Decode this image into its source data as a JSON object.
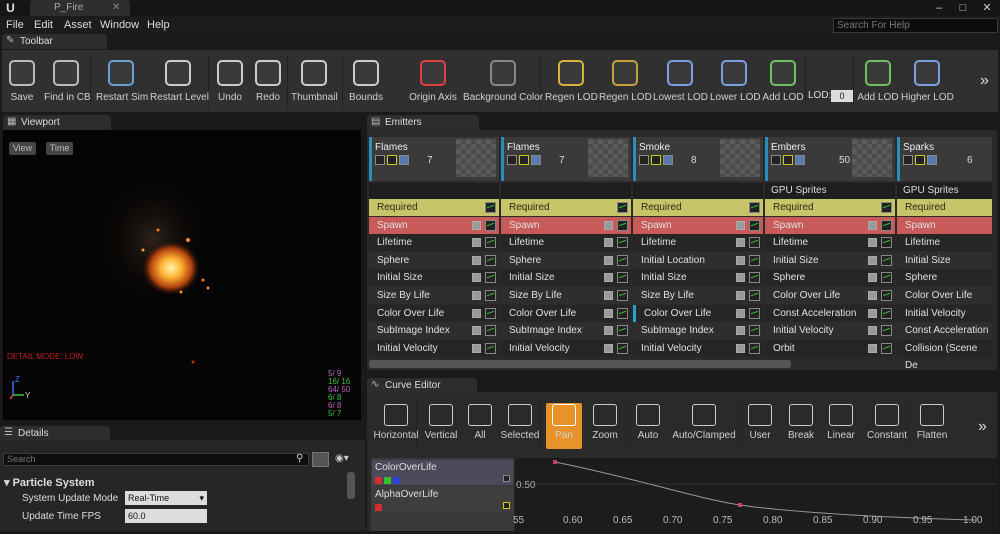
{
  "window": {
    "tab_title": "P_Fire",
    "logo": "U"
  },
  "menu": [
    "File",
    "Edit",
    "Asset",
    "Window",
    "Help"
  ],
  "help_search_placeholder": "Search For Help",
  "toolbar": {
    "tab": "Toolbar",
    "buttons": [
      {
        "label": "Save",
        "icon": "save-icon"
      },
      {
        "label": "Find in CB",
        "icon": "magnifier-icon"
      },
      {
        "label": "Restart Sim",
        "icon": "gear-icon"
      },
      {
        "label": "Restart Level",
        "icon": "refresh-icon"
      },
      {
        "label": "Undo",
        "icon": "undo-icon"
      },
      {
        "label": "Redo",
        "icon": "redo-icon"
      },
      {
        "label": "Thumbnail",
        "icon": "thumbnail-icon"
      },
      {
        "label": "Bounds",
        "icon": "bounds-icon"
      },
      {
        "label": "Origin Axis",
        "icon": "axis-icon"
      },
      {
        "label": "Background Color",
        "icon": "brush-icon"
      },
      {
        "label": "Regen LOD",
        "icon": "regen-lod-icon"
      },
      {
        "label": "Regen LOD",
        "icon": "regen-lod-alt-icon"
      },
      {
        "label": "Lowest LOD",
        "icon": "lowest-lod-icon"
      },
      {
        "label": "Lower LOD",
        "icon": "lower-lod-icon"
      },
      {
        "label": "Add LOD",
        "icon": "add-lod-icon"
      },
      {
        "label": "Add LOD",
        "icon": "add-lod-up-icon"
      },
      {
        "label": "Higher LOD",
        "icon": "higher-lod-icon"
      }
    ],
    "lod_label": "LOD:",
    "lod_value": "0"
  },
  "viewport": {
    "tab": "Viewport",
    "view_button": "View",
    "time_button": "Time",
    "detail_mode": "DETAIL MODE: LOW",
    "stats": [
      "5/ 9",
      "16/ 16",
      "64/ 50",
      "6/ 8",
      "6/ 8",
      "5/ 7"
    ]
  },
  "emitters": {
    "tab": "Emitters",
    "columns": [
      {
        "name": "Flames",
        "count": "7",
        "type": "",
        "color": "#2a8fbf",
        "modules": [
          "Required",
          "Spawn",
          "Lifetime",
          "Sphere",
          "Initial Size",
          "Size By Life",
          "Color Over Life",
          "SubImage Index",
          "Initial Velocity"
        ]
      },
      {
        "name": "Flames",
        "count": "7",
        "type": "",
        "color": "#2a8fbf",
        "modules": [
          "Required",
          "Spawn",
          "Lifetime",
          "Sphere",
          "Initial Size",
          "Size By Life",
          "Color Over Life",
          "SubImage Index",
          "Initial Velocity"
        ]
      },
      {
        "name": "Smoke",
        "count": "8",
        "type": "",
        "color": "#2a8fbf",
        "modules": [
          "Required",
          "Spawn",
          "Lifetime",
          "Initial Location",
          "Initial Size",
          "Size By Life",
          "Color Over Life",
          "SubImage Index",
          "Initial Velocity"
        ]
      },
      {
        "name": "Embers",
        "count": "50",
        "type": "GPU Sprites",
        "color": "#2a8fbf",
        "modules": [
          "Required",
          "Spawn",
          "Lifetime",
          "Initial Size",
          "Sphere",
          "Color Over Life",
          "Const Acceleration",
          "Initial Velocity",
          "Orbit"
        ]
      },
      {
        "name": "Sparks",
        "count": "6",
        "type": "GPU Sprites",
        "color": "#2a8fbf",
        "modules": [
          "Required",
          "Spawn",
          "Lifetime",
          "Initial Size",
          "Sphere",
          "Color Over Life",
          "Initial Velocity",
          "Const Acceleration",
          "Collision (Scene De"
        ]
      }
    ]
  },
  "curve_editor": {
    "tab": "Curve Editor",
    "buttons": [
      {
        "label": "Horizontal",
        "icon": "fit-horizontal-icon"
      },
      {
        "label": "Vertical",
        "icon": "fit-vertical-icon"
      },
      {
        "label": "All",
        "icon": "fit-all-icon"
      },
      {
        "label": "Selected",
        "icon": "fit-selected-icon"
      },
      {
        "label": "Pan",
        "icon": "pan-icon"
      },
      {
        "label": "Zoom",
        "icon": "zoom-icon"
      },
      {
        "label": "Auto",
        "icon": "auto-tangent-icon"
      },
      {
        "label": "Auto/Clamped",
        "icon": "auto-clamped-icon"
      },
      {
        "label": "User",
        "icon": "user-tangent-icon"
      },
      {
        "label": "Break",
        "icon": "break-tangent-icon"
      },
      {
        "label": "Linear",
        "icon": "linear-icon"
      },
      {
        "label": "Constant",
        "icon": "constant-icon"
      },
      {
        "label": "Flatten",
        "icon": "flatten-icon"
      }
    ],
    "tracks": [
      "ColorOverLife",
      "AlphaOverLife"
    ],
    "y_label": "0.50",
    "x_ticks": [
      "55",
      "0.60",
      "0.65",
      "0.70",
      "0.75",
      "0.80",
      "0.85",
      "0.90",
      "0.95",
      "1.00"
    ]
  },
  "details": {
    "tab": "Details",
    "search_placeholder": "Search",
    "section": "Particle System",
    "rows": [
      {
        "label": "System Update Mode",
        "value": "Real-Time"
      },
      {
        "label": "Update Time FPS",
        "value": "60.0"
      }
    ]
  },
  "colors": {
    "required": "#c8c46a",
    "spawn": "#c85a5a",
    "accent": "#e8922a"
  }
}
